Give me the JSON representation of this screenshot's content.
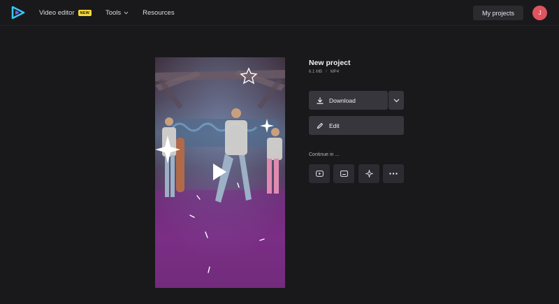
{
  "header": {
    "nav": {
      "video_editor": "Video editor",
      "new_badge": "NEW",
      "tools": "Tools",
      "resources": "Resources"
    },
    "my_projects": "My projects",
    "avatar_initial": "J"
  },
  "project": {
    "title": "New project",
    "size": "6.1 MB",
    "separator": "/",
    "format": "MP4"
  },
  "actions": {
    "download": "Download",
    "edit": "Edit",
    "continue_in": "Continue in ..."
  },
  "continue_icons": [
    "youtube-icon",
    "subtitles-icon",
    "sparkle-icon",
    "more-icon"
  ],
  "colors": {
    "background": "#19191c",
    "button": "#36363c",
    "badge": "#f5d83a",
    "avatar": "#e0545f",
    "logo_accent": "#35c7f0"
  }
}
